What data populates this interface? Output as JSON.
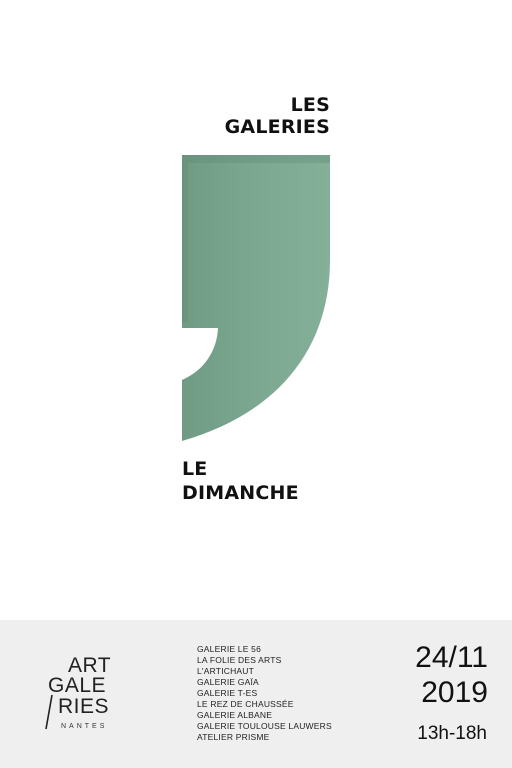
{
  "title": {
    "line1": "LES",
    "line2": "GALERIES",
    "line3": "LE",
    "line4": "DIMANCHE"
  },
  "colors": {
    "accent": "#7aa58e",
    "footer_bg": "#efefef",
    "text": "#111111"
  },
  "logo": {
    "art": "ART",
    "gale": "GALE",
    "ries": "RIES",
    "city": "NANTES"
  },
  "galleries": [
    "GALERIE LE 56",
    "LA FOLIE DES ARTS",
    "L'ARTICHAUT",
    "GALERIE GAÏA",
    "GALERIE T-ES",
    "LE REZ DE CHAUSSÉE",
    "GALERIE ALBANE",
    "GALERIE TOULOUSE LAUWERS",
    "ATELIER PRISME"
  ],
  "event": {
    "date_line1": "24/11",
    "date_line2": "2019",
    "hours": "13h-18h"
  }
}
